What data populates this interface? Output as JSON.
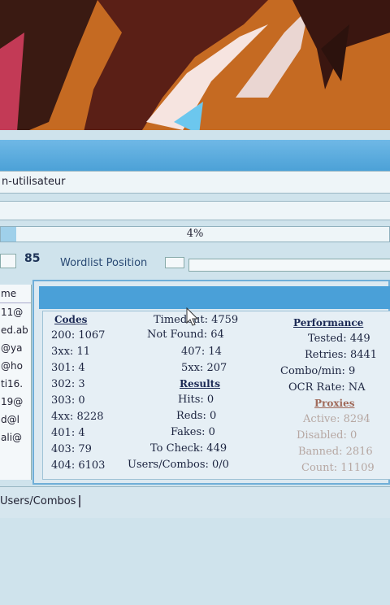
{
  "window": {
    "user_field": "n-utilisateur",
    "progress_percent": 4,
    "progress_text": "4%",
    "bot_count": "85",
    "wordlist_label": "Wordlist Position"
  },
  "list": {
    "header": "me",
    "items": [
      "11@",
      "ed.ab",
      "@ya",
      "@ho",
      "ti16.",
      "19@",
      "d@l",
      "ali@"
    ]
  },
  "codes": {
    "title": "Codes",
    "c200": "200: 1067",
    "c3xx": "3xx: 11",
    "c301": "301: 4",
    "c302": "302: 3",
    "c303": "303: 0",
    "c4xx": "4xx: 8228",
    "c401": "401: 4",
    "c403": "403: 79",
    "c404": "404: 6103"
  },
  "middle": {
    "timedout": "Timedout: 4759",
    "not_found": "Not Found: 64",
    "c407": "407: 14",
    "c5xx": "5xx: 207",
    "results_title": "Results",
    "hits": "Hits: 0",
    "reds": "Reds: 0",
    "fakes": "Fakes: 0",
    "to_check": "To Check: 449",
    "users_combos": "Users/Combos: 0/0"
  },
  "performance": {
    "title": "Performance",
    "tested": "Tested: 449",
    "retries": "Retries: 8441",
    "combo_min": "Combo/min: 9",
    "ocr_rate": "OCR Rate: NA"
  },
  "proxies": {
    "title": "Proxies",
    "active": "Active: 8294",
    "disabled": "Disabled: 0",
    "banned": "Banned: 2816",
    "count": "Count: 11109"
  },
  "status": {
    "tab": "Users/Combos"
  },
  "colors": {
    "accent": "#4aa0d8",
    "wallpaper": "#c0651c"
  }
}
